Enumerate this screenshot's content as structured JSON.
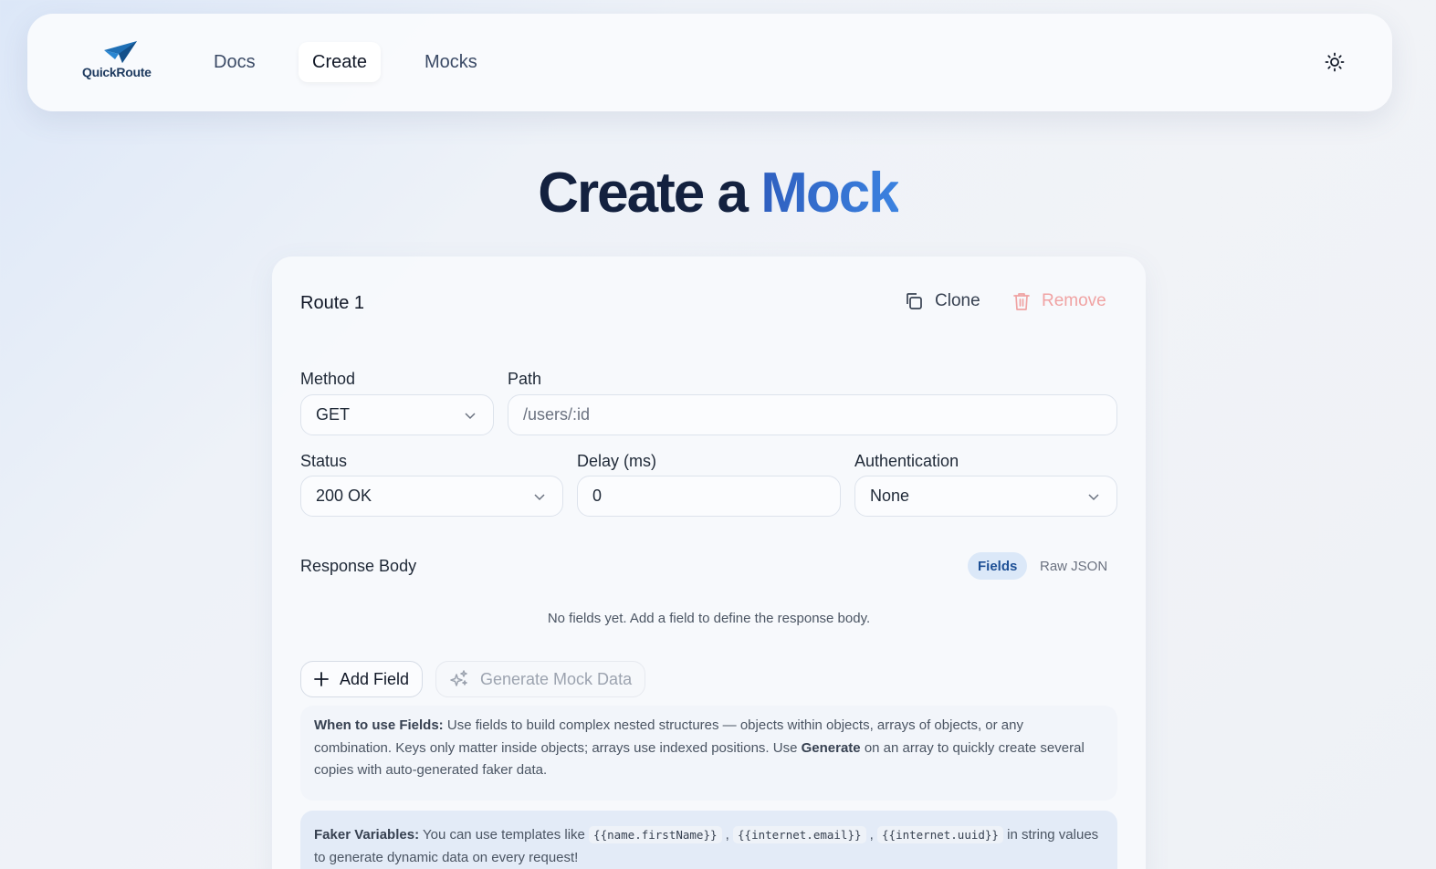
{
  "nav": {
    "logo_text": "QuickRoute",
    "links": [
      {
        "label": "Docs"
      },
      {
        "label": "Create"
      },
      {
        "label": "Mocks"
      }
    ],
    "active": "Create",
    "theme_icon": "sun-icon"
  },
  "page": {
    "title_part1": "Create a",
    "title_part2": "Mock"
  },
  "route": {
    "title": "Route 1",
    "clone_label": "Clone",
    "remove_label": "Remove",
    "method_label": "Method",
    "method_value": "GET",
    "path_label": "Path",
    "path_placeholder": "/users/:id",
    "status_label": "Status",
    "status_value": "200 OK",
    "delay_label": "Delay (ms)",
    "delay_value": "0",
    "auth_label": "Authentication",
    "auth_value": "None"
  },
  "response": {
    "title": "Response Body",
    "tabs": [
      {
        "label": "Fields"
      },
      {
        "label": "Raw JSON"
      }
    ],
    "active_tab": "Fields",
    "empty_message": "No fields yet. Add a field to define the response body.",
    "add_field_label": "Add Field",
    "generate_label": "Generate Mock Data"
  },
  "help": {
    "fields_heading": "When to use Fields:",
    "fields_text_1": " Use fields to build complex nested structures — objects within objects, arrays of objects, or any combination. Keys only matter inside objects; arrays use indexed positions. Use ",
    "fields_bold": "Generate",
    "fields_text_2": " on an array to quickly create several copies with auto-generated faker data.",
    "faker_heading": "Faker Variables:",
    "faker_text_1": " You can use templates like ",
    "faker_code_1": "{{name.firstName}}",
    "faker_sep": " , ",
    "faker_code_2": "{{internet.email}}",
    "faker_code_3": "{{internet.uuid}}",
    "faker_text_2": " in string values to generate dynamic data on every request!"
  },
  "colors": {
    "accent": "#2f5fbf",
    "title_dark": "#13213f",
    "remove": "#f0a3a3",
    "active_tab_bg": "#dbe8f8"
  }
}
